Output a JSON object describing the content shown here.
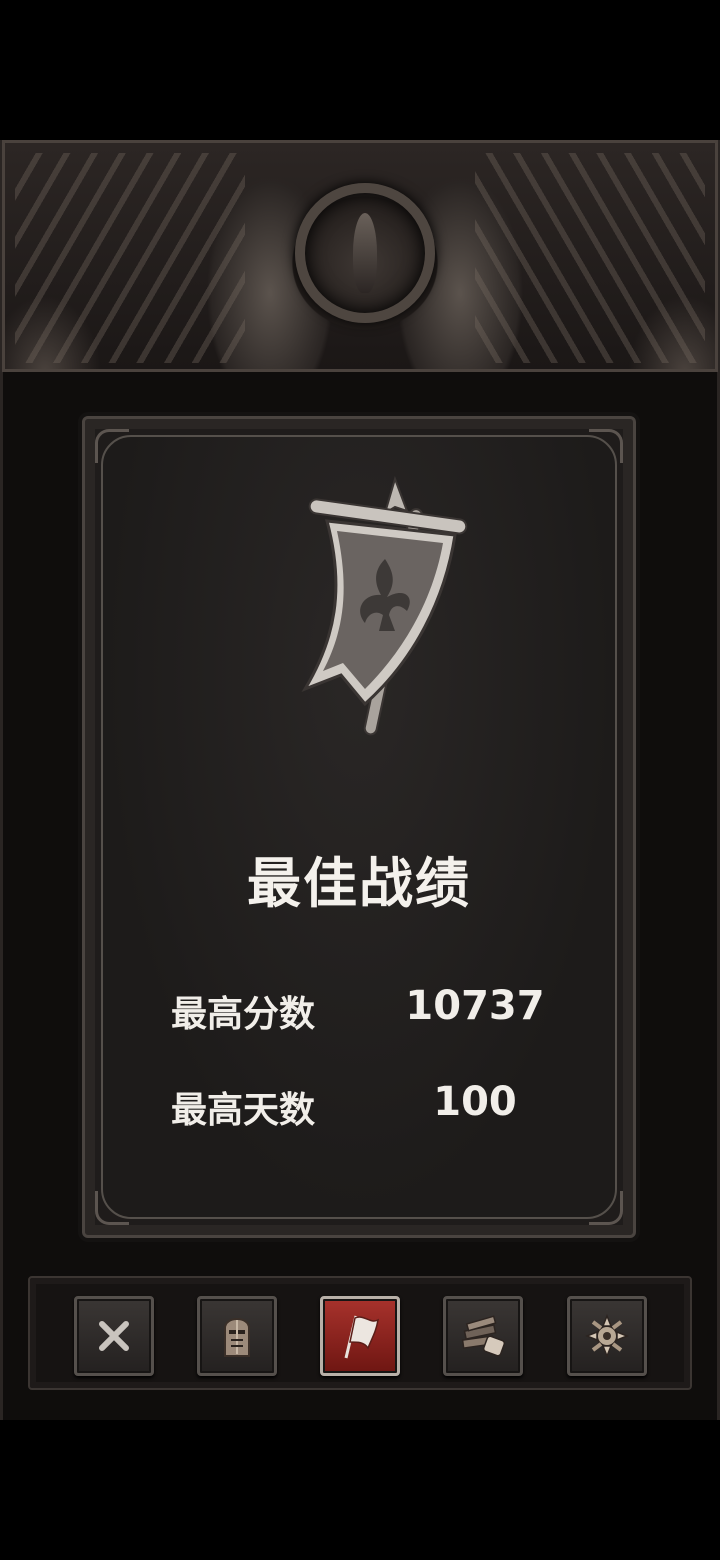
{
  "panel": {
    "title": "最佳战绩",
    "stats": [
      {
        "label": "最高分数",
        "value": "10737"
      },
      {
        "label": "最高天数",
        "value": "100"
      }
    ],
    "emblem_icon": "war-banner-icon"
  },
  "toolbar": {
    "buttons": [
      {
        "icon": "close-icon",
        "active": false
      },
      {
        "icon": "knight-helmet-icon",
        "active": false
      },
      {
        "icon": "flag-icon",
        "active": true
      },
      {
        "icon": "books-scroll-icon",
        "active": false
      },
      {
        "icon": "gear-settings-icon",
        "active": false
      }
    ]
  },
  "colors": {
    "background": "#000000",
    "panel": "#1f1c1b",
    "frame": "#4a4440",
    "text": "#f4f1ec",
    "active_button": "#a8322c"
  }
}
